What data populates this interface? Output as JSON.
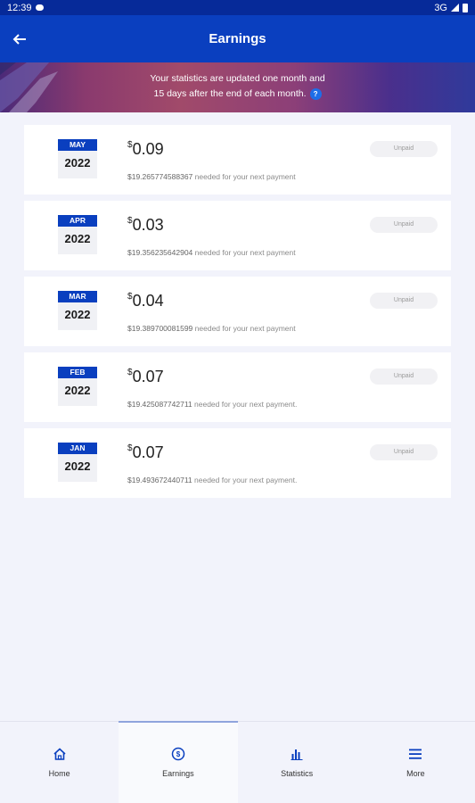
{
  "status_bar": {
    "time": "12:39",
    "network": "3G"
  },
  "header": {
    "title": "Earnings",
    "back_icon": "arrow-left-icon"
  },
  "banner": {
    "line1": "Your statistics are updated one month and",
    "line2": "15 days after the end of each month.",
    "help_label": "?"
  },
  "earnings": [
    {
      "month": "MAY",
      "year": "2022",
      "currency": "$",
      "amount": "0.09",
      "needed_value": "$19.265774588367",
      "needed_text": "needed for your next payment",
      "status": "Unpaid"
    },
    {
      "month": "APR",
      "year": "2022",
      "currency": "$",
      "amount": "0.03",
      "needed_value": "$19.356235642904",
      "needed_text": "needed for your next payment",
      "status": "Unpaid"
    },
    {
      "month": "MAR",
      "year": "2022",
      "currency": "$",
      "amount": "0.04",
      "needed_value": "$19.389700081599",
      "needed_text": "needed for your next payment",
      "status": "Unpaid"
    },
    {
      "month": "FEB",
      "year": "2022",
      "currency": "$",
      "amount": "0.07",
      "needed_value": "$19.425087742711",
      "needed_text": "needed for your next payment.",
      "status": "Unpaid"
    },
    {
      "month": "JAN",
      "year": "2022",
      "currency": "$",
      "amount": "0.07",
      "needed_value": "$19.493672440711",
      "needed_text": "needed for your next payment.",
      "status": "Unpaid"
    }
  ],
  "nav": [
    {
      "label": "Home",
      "icon": "home-icon"
    },
    {
      "label": "Earnings",
      "icon": "dollar-circle-icon",
      "active": true
    },
    {
      "label": "Statistics",
      "icon": "bar-chart-icon"
    },
    {
      "label": "More",
      "icon": "menu-icon"
    }
  ],
  "colors": {
    "primary": "#0a3fbf",
    "status_bar": "#062a99",
    "background": "#f2f3fb"
  }
}
